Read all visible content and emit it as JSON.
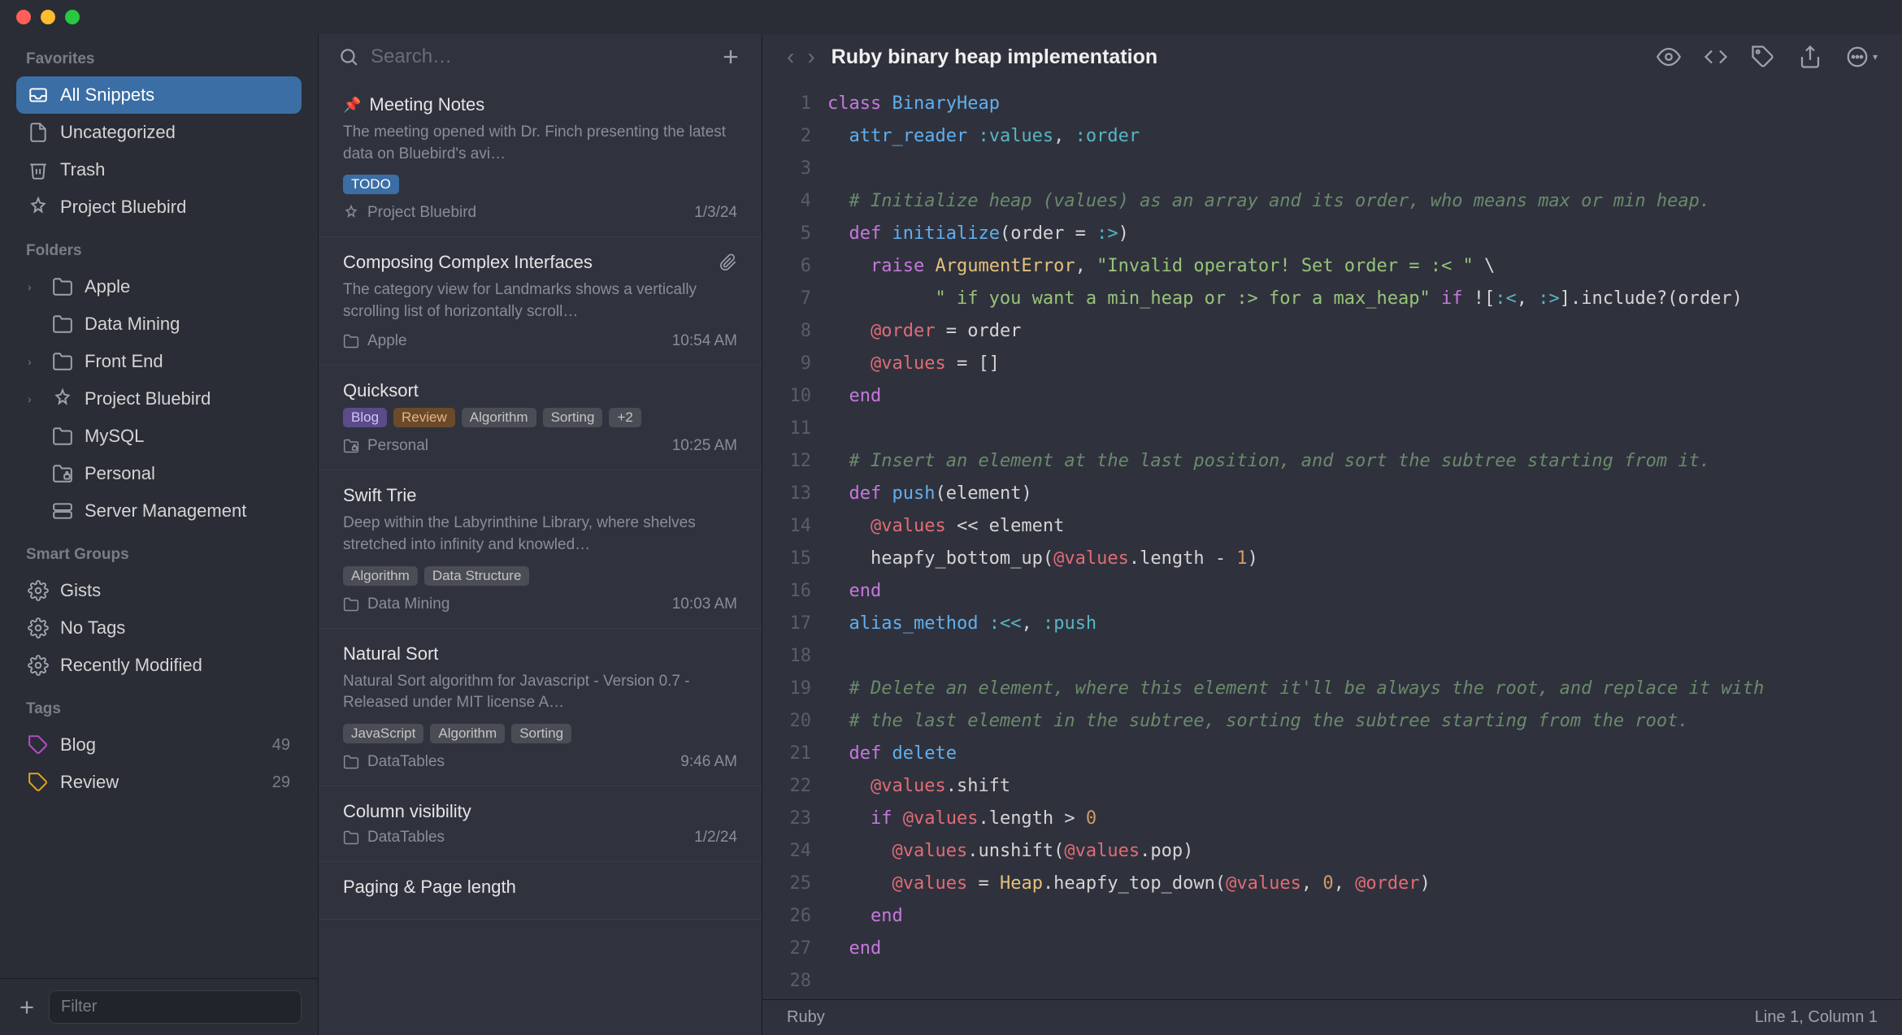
{
  "sidebar": {
    "favorites_header": "Favorites",
    "favorites": [
      {
        "label": "All Snippets",
        "icon": "tray",
        "selected": true
      },
      {
        "label": "Uncategorized",
        "icon": "doc"
      },
      {
        "label": "Trash",
        "icon": "trash"
      },
      {
        "label": "Project Bluebird",
        "icon": "smart"
      }
    ],
    "folders_header": "Folders",
    "folders": [
      {
        "label": "Apple",
        "chevron": true,
        "icon": "folder"
      },
      {
        "label": "Data Mining",
        "chevron": false,
        "icon": "folder"
      },
      {
        "label": "Front End",
        "chevron": true,
        "icon": "folder"
      },
      {
        "label": "Project Bluebird",
        "chevron": true,
        "icon": "smart"
      },
      {
        "label": "MySQL",
        "chevron": false,
        "icon": "folder"
      },
      {
        "label": "Personal",
        "chevron": false,
        "icon": "folder-lock"
      },
      {
        "label": "Server Management",
        "chevron": false,
        "icon": "server"
      }
    ],
    "smart_header": "Smart Groups",
    "smart": [
      {
        "label": "Gists",
        "icon": "gear"
      },
      {
        "label": "No Tags",
        "icon": "gear"
      },
      {
        "label": "Recently Modified",
        "icon": "gear"
      }
    ],
    "tags_header": "Tags",
    "tags": [
      {
        "label": "Blog",
        "count": "49",
        "color": "#b84ec9"
      },
      {
        "label": "Review",
        "count": "29",
        "color": "#e5a623"
      }
    ],
    "filter_placeholder": "Filter"
  },
  "search_placeholder": "Search…",
  "snippets": [
    {
      "title": "Meeting Notes",
      "pinned": true,
      "preview": "The meeting opened with Dr. Finch presenting the latest data on Bluebird's avi…",
      "chips": [
        {
          "label": "TODO",
          "style": "blue"
        }
      ],
      "folder": "Project Bluebird",
      "folder_icon": "smart",
      "date": "1/3/24"
    },
    {
      "title": "Composing Complex Interfaces",
      "attachment": true,
      "preview": "The category view for Landmarks shows a vertically scrolling list of horizontally scroll…",
      "folder": "Apple",
      "date": "10:54 AM"
    },
    {
      "title": "Quicksort",
      "chips": [
        {
          "label": "Blog",
          "style": "purple"
        },
        {
          "label": "Review",
          "style": "orange"
        },
        {
          "label": "Algorithm",
          "style": "gray"
        },
        {
          "label": "Sorting",
          "style": "gray"
        },
        {
          "label": "+2",
          "style": "gray"
        }
      ],
      "folder": "Personal",
      "folder_icon": "folder-lock",
      "date": "10:25 AM"
    },
    {
      "title": "Swift Trie",
      "preview": "Deep within the Labyrinthine Library, where shelves stretched into infinity and knowled…",
      "chips": [
        {
          "label": "Algorithm",
          "style": "gray"
        },
        {
          "label": "Data Structure",
          "style": "gray"
        }
      ],
      "folder": "Data Mining",
      "date": "10:03 AM"
    },
    {
      "title": "Natural Sort",
      "preview": "Natural Sort algorithm for Javascript - Version 0.7 - Released under MIT license A…",
      "chips": [
        {
          "label": "JavaScript",
          "style": "gray"
        },
        {
          "label": "Algorithm",
          "style": "gray"
        },
        {
          "label": "Sorting",
          "style": "gray"
        }
      ],
      "folder": "DataTables",
      "date": "9:46 AM"
    },
    {
      "title": "Column visibility",
      "folder": "DataTables",
      "date": "1/2/24"
    },
    {
      "title": "Paging & Page length"
    }
  ],
  "editor": {
    "title": "Ruby binary heap implementation",
    "lang": "Ruby",
    "position": "Line 1, Column 1",
    "code_lines": [
      [
        {
          "t": "class ",
          "c": "kw"
        },
        {
          "t": "BinaryHeap",
          "c": "class"
        }
      ],
      [
        {
          "t": "  ",
          "c": ""
        },
        {
          "t": "attr_reader",
          "c": "method"
        },
        {
          "t": " ",
          "c": ""
        },
        {
          "t": ":values",
          "c": "sym"
        },
        {
          "t": ", ",
          "c": ""
        },
        {
          "t": ":order",
          "c": "sym"
        }
      ],
      [],
      [
        {
          "t": "  ",
          "c": ""
        },
        {
          "t": "# Initialize heap (values) as an array and its order, who means max or min heap.",
          "c": "comment"
        }
      ],
      [
        {
          "t": "  ",
          "c": ""
        },
        {
          "t": "def",
          "c": "def"
        },
        {
          "t": " ",
          "c": ""
        },
        {
          "t": "initialize",
          "c": "fn"
        },
        {
          "t": "(order = ",
          "c": ""
        },
        {
          "t": ":>",
          "c": "sym"
        },
        {
          "t": ")",
          "c": ""
        }
      ],
      [
        {
          "t": "    ",
          "c": ""
        },
        {
          "t": "raise",
          "c": "kw"
        },
        {
          "t": " ",
          "c": ""
        },
        {
          "t": "ArgumentError",
          "c": "const"
        },
        {
          "t": ", ",
          "c": ""
        },
        {
          "t": "\"Invalid operator! Set order = :< \"",
          "c": "str"
        },
        {
          "t": " \\",
          "c": ""
        }
      ],
      [
        {
          "t": "          ",
          "c": ""
        },
        {
          "t": "\" if you want a min_heap or :> for a max_heap\"",
          "c": "str"
        },
        {
          "t": " ",
          "c": ""
        },
        {
          "t": "if",
          "c": "kw"
        },
        {
          "t": " ![",
          "c": ""
        },
        {
          "t": ":<",
          "c": "sym"
        },
        {
          "t": ", ",
          "c": ""
        },
        {
          "t": ":>",
          "c": "sym"
        },
        {
          "t": "].include?(order)",
          "c": ""
        }
      ],
      [
        {
          "t": "    ",
          "c": ""
        },
        {
          "t": "@order",
          "c": "ivar"
        },
        {
          "t": " = order",
          "c": ""
        }
      ],
      [
        {
          "t": "    ",
          "c": ""
        },
        {
          "t": "@values",
          "c": "ivar"
        },
        {
          "t": " = []",
          "c": ""
        }
      ],
      [
        {
          "t": "  ",
          "c": ""
        },
        {
          "t": "end",
          "c": "kw"
        }
      ],
      [],
      [
        {
          "t": "  ",
          "c": ""
        },
        {
          "t": "# Insert an element at the last position, and sort the subtree starting from it.",
          "c": "comment"
        }
      ],
      [
        {
          "t": "  ",
          "c": ""
        },
        {
          "t": "def",
          "c": "def"
        },
        {
          "t": " ",
          "c": ""
        },
        {
          "t": "push",
          "c": "fn"
        },
        {
          "t": "(element)",
          "c": ""
        }
      ],
      [
        {
          "t": "    ",
          "c": ""
        },
        {
          "t": "@values",
          "c": "ivar"
        },
        {
          "t": " << element",
          "c": ""
        }
      ],
      [
        {
          "t": "    heapfy_bottom_up(",
          "c": ""
        },
        {
          "t": "@values",
          "c": "ivar"
        },
        {
          "t": ".length - ",
          "c": ""
        },
        {
          "t": "1",
          "c": "num"
        },
        {
          "t": ")",
          "c": ""
        }
      ],
      [
        {
          "t": "  ",
          "c": ""
        },
        {
          "t": "end",
          "c": "kw"
        }
      ],
      [
        {
          "t": "  ",
          "c": ""
        },
        {
          "t": "alias_method",
          "c": "method"
        },
        {
          "t": " ",
          "c": ""
        },
        {
          "t": ":<<",
          "c": "sym"
        },
        {
          "t": ", ",
          "c": ""
        },
        {
          "t": ":push",
          "c": "sym"
        }
      ],
      [],
      [
        {
          "t": "  ",
          "c": ""
        },
        {
          "t": "# Delete an element, where this element it'll be always the root, and replace it with",
          "c": "comment"
        }
      ],
      [
        {
          "t": "  ",
          "c": ""
        },
        {
          "t": "# the last element in the subtree, sorting the subtree starting from the root.",
          "c": "comment"
        }
      ],
      [
        {
          "t": "  ",
          "c": ""
        },
        {
          "t": "def",
          "c": "def"
        },
        {
          "t": " ",
          "c": ""
        },
        {
          "t": "delete",
          "c": "fn"
        }
      ],
      [
        {
          "t": "    ",
          "c": ""
        },
        {
          "t": "@values",
          "c": "ivar"
        },
        {
          "t": ".shift",
          "c": ""
        }
      ],
      [
        {
          "t": "    ",
          "c": ""
        },
        {
          "t": "if",
          "c": "kw"
        },
        {
          "t": " ",
          "c": ""
        },
        {
          "t": "@values",
          "c": "ivar"
        },
        {
          "t": ".length > ",
          "c": ""
        },
        {
          "t": "0",
          "c": "num"
        }
      ],
      [
        {
          "t": "      ",
          "c": ""
        },
        {
          "t": "@values",
          "c": "ivar"
        },
        {
          "t": ".unshift(",
          "c": ""
        },
        {
          "t": "@values",
          "c": "ivar"
        },
        {
          "t": ".pop)",
          "c": ""
        }
      ],
      [
        {
          "t": "      ",
          "c": ""
        },
        {
          "t": "@values",
          "c": "ivar"
        },
        {
          "t": " = ",
          "c": ""
        },
        {
          "t": "Heap",
          "c": "const"
        },
        {
          "t": ".heapfy_top_down(",
          "c": ""
        },
        {
          "t": "@values",
          "c": "ivar"
        },
        {
          "t": ", ",
          "c": ""
        },
        {
          "t": "0",
          "c": "num"
        },
        {
          "t": ", ",
          "c": ""
        },
        {
          "t": "@order",
          "c": "ivar"
        },
        {
          "t": ")",
          "c": ""
        }
      ],
      [
        {
          "t": "    ",
          "c": ""
        },
        {
          "t": "end",
          "c": "kw"
        }
      ],
      [
        {
          "t": "  ",
          "c": ""
        },
        {
          "t": "end",
          "c": "kw"
        }
      ]
    ]
  }
}
